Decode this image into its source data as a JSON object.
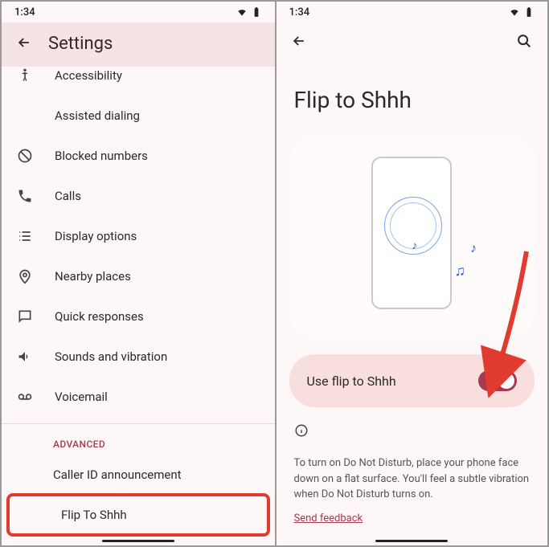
{
  "status": {
    "time": "1:34"
  },
  "left": {
    "header_title": "Settings",
    "items": [
      {
        "label": "Accessibility"
      },
      {
        "label": "Assisted dialing"
      },
      {
        "label": "Blocked numbers"
      },
      {
        "label": "Calls"
      },
      {
        "label": "Display options"
      },
      {
        "label": "Nearby places"
      },
      {
        "label": "Quick responses"
      },
      {
        "label": "Sounds and vibration"
      },
      {
        "label": "Voicemail"
      }
    ],
    "section_label": "ADVANCED",
    "advanced_items": [
      {
        "label": "Caller ID announcement"
      },
      {
        "label": "Flip To Shhh"
      }
    ]
  },
  "right": {
    "page_title": "Flip to Shhh",
    "toggle_label": "Use flip to Shhh",
    "toggle_on": true,
    "description": "To turn on Do Not Disturb, place your phone face down on a flat surface. You'll feel a subtle vibration when Do Not Disturb turns on.",
    "feedback_link": "Send feedback"
  }
}
